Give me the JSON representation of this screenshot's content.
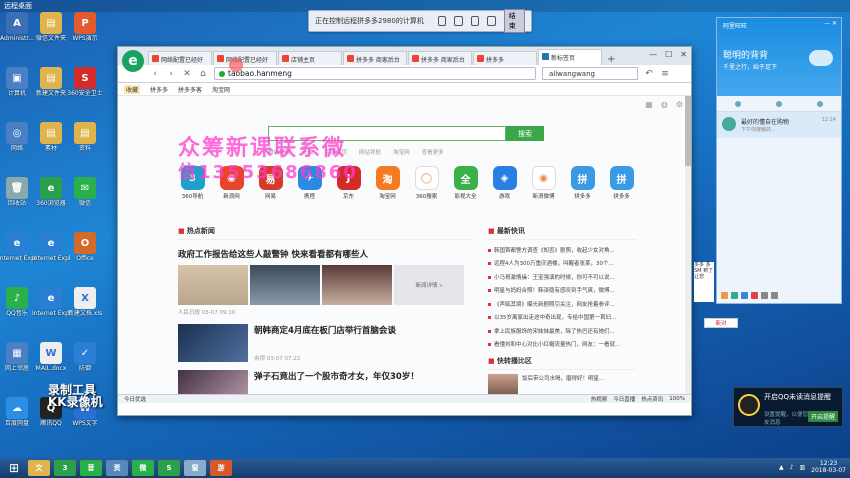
{
  "desktop": {
    "title": "远程桌面",
    "icons": [
      {
        "label": "Administr...",
        "color": "#3a6fb8",
        "glyph": "A"
      },
      {
        "label": "微信文件夹",
        "color": "#e0b44c",
        "glyph": "▤"
      },
      {
        "label": "WPS演示",
        "color": "#e35b2c",
        "glyph": "P"
      },
      {
        "label": "计算机",
        "color": "#4a7fc4",
        "glyph": "▣"
      },
      {
        "label": "新建文件夹",
        "color": "#e0b44c",
        "glyph": "▤"
      },
      {
        "label": "360安全卫士",
        "color": "#d42a2a",
        "glyph": "S"
      },
      {
        "label": "网络",
        "color": "#4a7fc4",
        "glyph": "◎"
      },
      {
        "label": "素材",
        "color": "#e0b44c",
        "glyph": "▤"
      },
      {
        "label": "资料",
        "color": "#e0b44c",
        "glyph": "▤"
      },
      {
        "label": "回收站",
        "color": "#8aa",
        "glyph": "🗑"
      },
      {
        "label": "360浏览器",
        "color": "#2aa04a",
        "glyph": "e"
      },
      {
        "label": "微信",
        "color": "#2ab04a",
        "glyph": "✉"
      },
      {
        "label": "Internet Explorer",
        "color": "#2a7fd4",
        "glyph": "e"
      },
      {
        "label": "Internet Explorer",
        "color": "#2a7fd4",
        "glyph": "e"
      },
      {
        "label": "Office",
        "color": "#d46a2a",
        "glyph": "O"
      },
      {
        "label": "QQ音乐",
        "color": "#2ab04a",
        "glyph": "♪"
      },
      {
        "label": "Internet Explorer",
        "color": "#2a7fd4",
        "glyph": "e"
      },
      {
        "label": "新建文档.xls",
        "color": "#eee",
        "glyph": "X"
      },
      {
        "label": "网上邻居",
        "color": "#4a7fc4",
        "glyph": "▦"
      },
      {
        "label": "MAIL.docx",
        "color": "#eee",
        "glyph": "W"
      },
      {
        "label": "防御",
        "color": "#2a7fd4",
        "glyph": "✓"
      },
      {
        "label": "百度网盘",
        "color": "#2a8fe4",
        "glyph": "☁"
      },
      {
        "label": "腾讯QQ",
        "color": "#222",
        "glyph": "Q"
      },
      {
        "label": "WPS文字",
        "color": "#2a6fd4",
        "glyph": "W"
      }
    ]
  },
  "remote_bar": {
    "text": "正在控制远程拼多多2980的计算机",
    "button": "结束"
  },
  "browser": {
    "logo": "e",
    "tabs": [
      "网络配置已经好",
      "网络配置已经好",
      "店铺主页",
      "拼多多 商家后台",
      "拼多多 商家后台",
      "拼多多",
      "新标签页"
    ],
    "url": "taobao.hanmeng",
    "search_engine_text": "aliwangwang",
    "bookmarks": [
      "收藏",
      "拼多多",
      "拼多多客",
      "淘宝网"
    ],
    "search_button": "搜索",
    "hot_words": [
      "腾讯视频",
      "天猫",
      "百度首页",
      "网站导航",
      "淘宝网",
      "查看更多"
    ],
    "apps": [
      {
        "label": "360导航",
        "color": "#1fa0c8",
        "glyph": "3"
      },
      {
        "label": "新浪网",
        "color": "#e8442c",
        "glyph": "◉"
      },
      {
        "label": "网易",
        "color": "#d63a2a",
        "glyph": "易"
      },
      {
        "label": "携程",
        "color": "#2a8ae4",
        "glyph": "✈"
      },
      {
        "label": "京东",
        "color": "#d42a2a",
        "glyph": "J"
      },
      {
        "label": "淘宝网",
        "color": "#f57a22",
        "glyph": "淘"
      },
      {
        "label": "360搜索",
        "color": "#fff",
        "glyph": "◯"
      },
      {
        "label": "影视大全",
        "color": "#3ab04a",
        "glyph": "全"
      },
      {
        "label": "游戏",
        "color": "#2a7fe4",
        "glyph": "◈"
      },
      {
        "label": "新浪微博",
        "color": "#fff",
        "glyph": "◉"
      },
      {
        "label": "拼多多",
        "color": "#3a9ae4",
        "glyph": "拼"
      },
      {
        "label": "拼多多",
        "color": "#3a9ae4",
        "glyph": "拼"
      }
    ],
    "watermark_line1": "众筹新课联系微",
    "watermark_line2": "信13553686860",
    "news": {
      "section": "热点新闻",
      "headline": "政府工作报告给这些人敲警钟 快来看看都有哪些人",
      "headline_meta": "人民日报 03-07 09:10",
      "more": "新闻详情 »",
      "items": [
        {
          "title": "朝韩商定4月底在板门店举行首脑会谈",
          "meta": "央视 03-07 07:22"
        },
        {
          "title": "弹子石竟出了一个股市奇才女，年仅30岁！",
          "meta": "年轻人大幅度收益，有人发问：弹子石里面出了个股市奇才女"
        }
      ]
    },
    "right_col": {
      "section": "最新快讯",
      "items": [
        "韩国首都警方调查《知否》剧照，收起少女对角...",
        "远程4人为300万重庆酒楼，叫醒者张某，30个...",
        "小马哥激情操：王宝强演的时候，你可不可以说...",
        "明星与妈妈合照！韩泽隐有感叹到手气爽，微博...",
        "《声临其境》曝光新剧照引关注，网友抢着参评...",
        "以35岁离家出走途中奇出现，专给中国第一首妇...",
        "拿上民族服饰的宋妹妹最美，除了热巴还有她们...",
        "看懂刘和中心对比小红帽流量热门，网友：一看就..."
      ],
      "quick_section": "快转播比区",
      "quick_text": "饭后带公司水喝，磨得好！明星..."
    },
    "status_left": "今日优选",
    "status_right": [
      "热视频",
      "今日直播",
      "热点资讯",
      "100%"
    ]
  },
  "qq": {
    "window_title": "阿里旺旺",
    "status_items": [
      "阿里",
      "—",
      "✕"
    ],
    "name": "聪明的背背",
    "signature": "千里之行，始于足下",
    "chat_name": "最好的懂自在购物",
    "chat_sub": "下午你接触的...",
    "chat_time": "12:24"
  },
  "notify": {
    "title": "开启QQ未读消息提醒",
    "subtitle": "设置提醒，以便您及时回复好友消息",
    "button": "开启提醒"
  },
  "side_btn": "新对",
  "left_watermark": "录制工具\nKK录像机",
  "taskbar": {
    "apps": [
      {
        "label": "文件夹",
        "color": "#e0b44c"
      },
      {
        "label": "360",
        "color": "#2aa04a"
      },
      {
        "label": "音乐",
        "color": "#2ab04a"
      },
      {
        "label": "资源",
        "color": "#5588bb"
      },
      {
        "label": "微信",
        "color": "#2ab04a"
      },
      {
        "label": "S",
        "color": "#2aa04a"
      },
      {
        "label": "窗口",
        "color": "#88aacc"
      },
      {
        "label": "游戏",
        "color": "#d45a2a"
      }
    ],
    "time": "12:23",
    "date": "2018-03-07"
  }
}
